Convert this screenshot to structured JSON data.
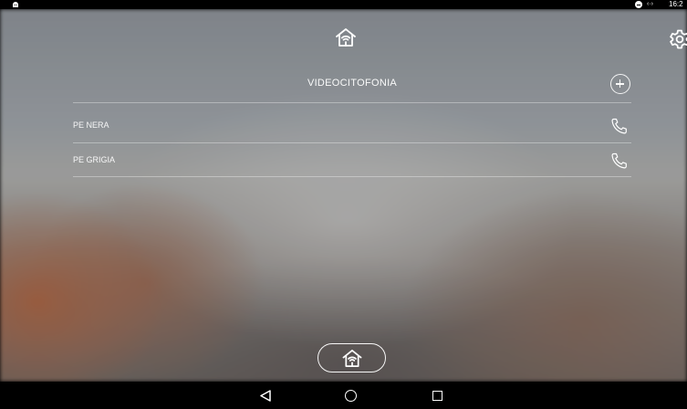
{
  "status_bar": {
    "time": "16:2",
    "icons": [
      "android-icon",
      "do-not-disturb-icon",
      "signal-icon"
    ]
  },
  "header": {
    "home_icon": "home-wifi-icon",
    "settings_icon": "gear-icon"
  },
  "panel": {
    "title": "VIDEOCITOFONIA",
    "add_icon": "plus-circle-icon",
    "items": [
      {
        "label": "PE NERA",
        "icon": "phone-icon"
      },
      {
        "label": "PE GRIGIA",
        "icon": "phone-icon"
      }
    ]
  },
  "bottom": {
    "home_button_icon": "home-wifi-icon"
  },
  "navigation_bar": {
    "buttons": [
      "back-icon",
      "home-icon",
      "recents-icon"
    ]
  },
  "colors": {
    "foreground": "#ffffff",
    "bars": "#000000"
  }
}
